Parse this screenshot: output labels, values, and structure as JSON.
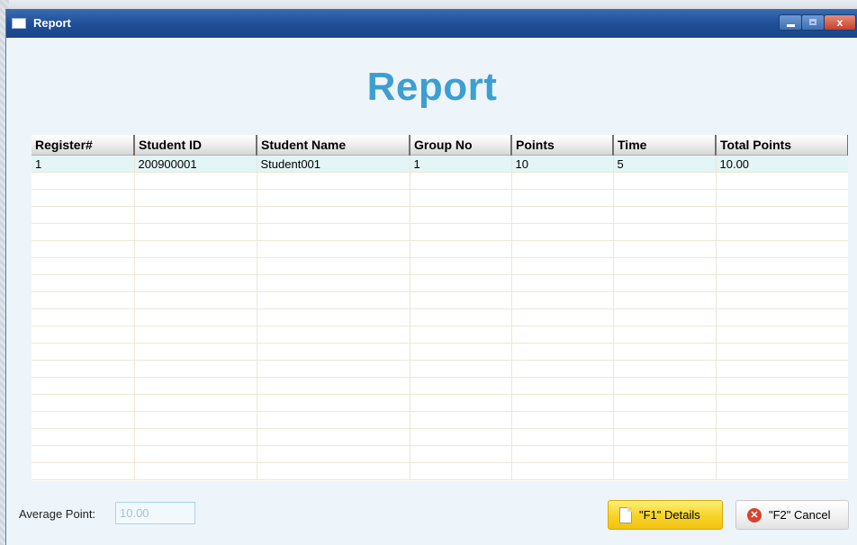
{
  "window": {
    "title": "Report",
    "controls": {
      "minimize": "",
      "maximize": "",
      "close": "x"
    }
  },
  "heading": "Report",
  "table": {
    "columns": [
      "Register#",
      "Student ID",
      "Student Name",
      "Group No",
      "Points",
      "Time",
      "Total Points"
    ],
    "rows": [
      [
        "1",
        "200900001",
        "Student001",
        "1",
        "10",
        "5",
        "10.00"
      ]
    ]
  },
  "footer": {
    "average_label": "Average Point:",
    "average_value": "10.00",
    "details_button": "\"F1\" Details",
    "cancel_button": "\"F2\" Cancel"
  },
  "colors": {
    "title_bar": "#1f4f98",
    "heading": "#3d9fd0",
    "details_button": "#f7d52c",
    "selected_row": "#e3f5f5"
  }
}
